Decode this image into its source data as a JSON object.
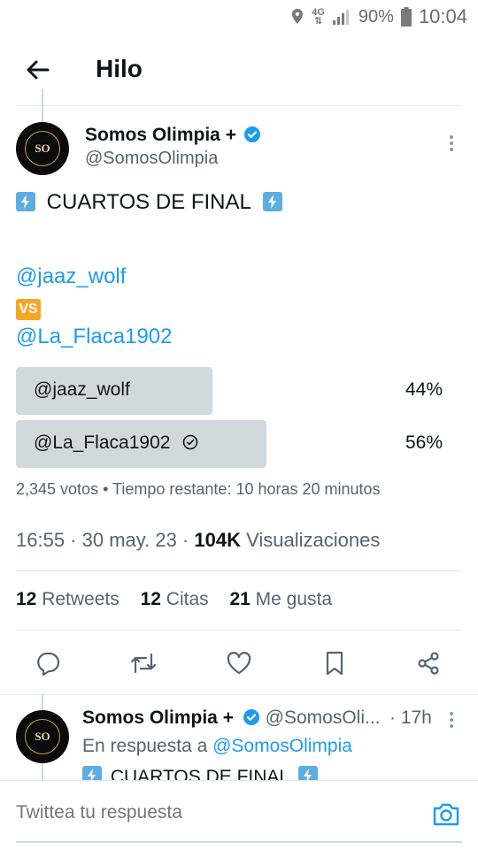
{
  "status_bar": {
    "network": "4G",
    "battery": "90%",
    "time": "10:04"
  },
  "header": {
    "title": "Hilo"
  },
  "tweet": {
    "author_name": "Somos Olimpia +",
    "author_handle": "@SomosOlimpia",
    "avatar_text": "SO",
    "line1_text": "CUARTOS DE FINAL",
    "mention1": "@jaaz_wolf",
    "vs_badge": "VS",
    "mention2": "@La_Flaca1902",
    "poll": {
      "options": [
        {
          "label": "@jaaz_wolf",
          "percent": "44%",
          "value": 0.44,
          "selected": false
        },
        {
          "label": "@La_Flaca1902",
          "percent": "56%",
          "value": 0.56,
          "selected": true
        }
      ],
      "meta": "2,345 votos • Tiempo restante: 10 horas 20 minutos"
    },
    "timestamp": "16:55 · 30 may. 23 · ",
    "views_count": "104K",
    "views_label": " Visualizaciones",
    "stats": {
      "retweets_count": "12",
      "retweets_label": " Retweets",
      "quotes_count": "12",
      "quotes_label": " Citas",
      "likes_count": "21",
      "likes_label": " Me gusta"
    }
  },
  "reply": {
    "author_name": "Somos Olimpia +",
    "author_handle": "@SomosOli...",
    "time": "· 17h",
    "reply_prefix": "En respuesta a ",
    "reply_to": "@SomosOlimpia",
    "preview_text": "CUARTOS DE FINAL"
  },
  "compose": {
    "placeholder": "Twittea tu respuesta"
  },
  "colors": {
    "accent": "#1d9bf0",
    "poll_bar": "#cfd9de",
    "secondary_text": "#536471",
    "vs_badge": "#f5a623",
    "bolt_badge": "#5dade2"
  },
  "icons": [
    "location-icon",
    "network-icon",
    "signal-icon",
    "battery-icon",
    "back-arrow-icon",
    "verified-icon",
    "more-icon",
    "check-circle-icon",
    "reply-icon",
    "retweet-icon",
    "like-icon",
    "bookmark-icon",
    "share-icon",
    "camera-icon"
  ]
}
